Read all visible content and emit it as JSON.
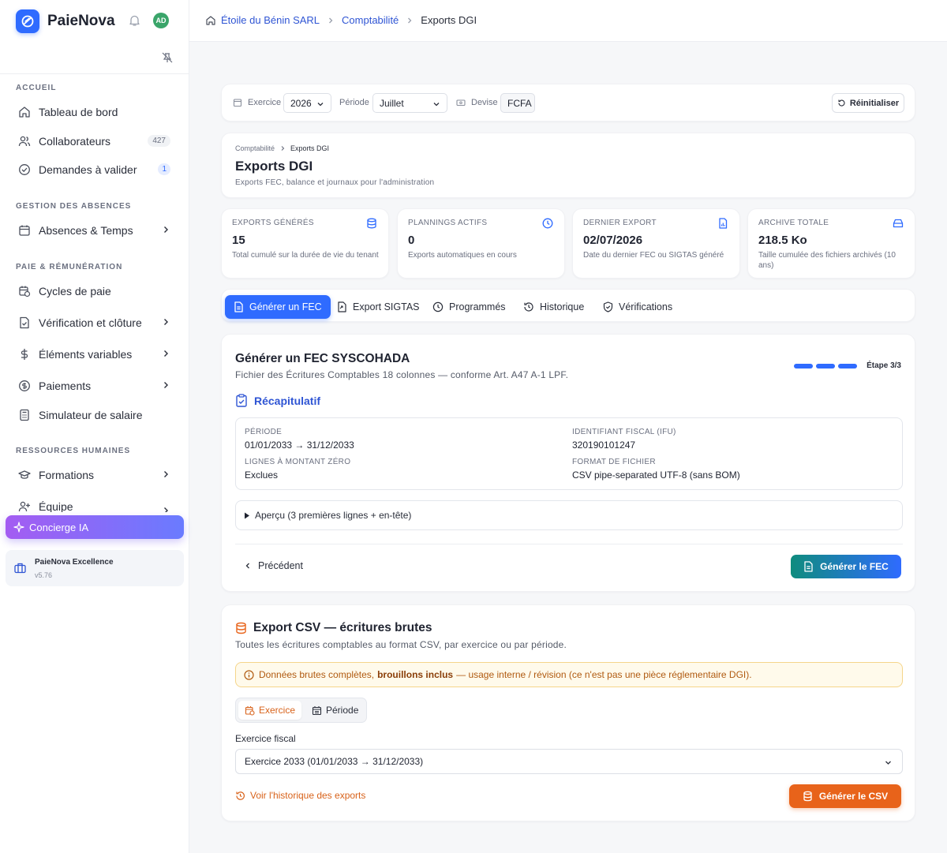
{
  "app": {
    "name": "PaieNova",
    "avatar_initials": "AD"
  },
  "sidebar": {
    "sections": [
      {
        "title": "ACCUEIL"
      },
      {
        "title": "GESTION DES ABSENCES"
      },
      {
        "title": "PAIE & RÉMUNÉRATION"
      },
      {
        "title": "RESSOURCES HUMAINES"
      }
    ],
    "items": [
      {
        "label": "Tableau de bord",
        "icon": "home-icon"
      },
      {
        "label": "Collaborateurs",
        "icon": "users-icon",
        "count": "427"
      },
      {
        "label": "Demandes à valider",
        "icon": "check-circle-icon",
        "count": "1"
      },
      {
        "label": "Absences & Temps",
        "icon": "calendar-icon"
      },
      {
        "label": "Cycles de paie",
        "icon": "calendar-clock-icon"
      },
      {
        "label": "Vérification et clôture",
        "icon": "file-check-icon"
      },
      {
        "label": "Éléments variables",
        "icon": "dollar-icon"
      },
      {
        "label": "Paiements",
        "icon": "coin-icon"
      },
      {
        "label": "Simulateur de salaire",
        "icon": "calculator-icon"
      },
      {
        "label": "Formations",
        "icon": "graduation-cap-icon"
      },
      {
        "label": "Équipe",
        "icon": "user-plus-icon"
      }
    ],
    "concierge": "Concierge IA",
    "plan": {
      "name": "PaieNova Excellence",
      "version": "v5.76"
    }
  },
  "breadcrumb": [
    "Étoile du Bénin SARL",
    "Comptabilité",
    "Exports DGI"
  ],
  "filters": {
    "exercice_label": "Exercice",
    "exercice_value": "2026",
    "periode_label": "Période",
    "periode_value": "Juillet",
    "devise_label": "Devise",
    "devise_value": "FCFA",
    "reset": "Réinitialiser"
  },
  "page": {
    "mini_crumb": [
      "Comptabilité",
      "Exports DGI"
    ],
    "title": "Exports DGI",
    "subtitle": "Exports FEC, balance et journaux pour l'administration"
  },
  "kpis": [
    {
      "label": "EXPORTS GÉNÉRÉS",
      "value": "15",
      "sub": "Total cumulé sur la durée de vie du tenant",
      "icon": "database-icon"
    },
    {
      "label": "PLANNINGS ACTIFS",
      "value": "0",
      "sub": "Exports automatiques en cours",
      "icon": "clock-icon"
    },
    {
      "label": "DERNIER EXPORT",
      "value": "02/07/2026",
      "sub": "Date du dernier FEC ou SIGTAS généré",
      "icon": "file-chart-icon"
    },
    {
      "label": "ARCHIVE TOTALE",
      "value": "218.5 Ko",
      "sub": "Taille cumulée des fichiers archivés (10 ans)",
      "icon": "archive-icon"
    }
  ],
  "tabs": [
    "Générer un FEC",
    "Export SIGTAS",
    "Programmés",
    "Historique",
    "Vérifications"
  ],
  "fec": {
    "title": "Générer un FEC SYSCOHADA",
    "subtitle": "Fichier des Écritures Comptables 18 colonnes — conforme Art. A47 A-1 LPF.",
    "step_text": "Étape 3/3",
    "steps_total": 3,
    "steps_done": 3,
    "recap_title": "Récapitulatif",
    "summary": {
      "periode_label": "PÉRIODE",
      "periode_value": "01/01/2033 → 31/12/2033",
      "zero_label": "LIGNES À MONTANT ZÉRO",
      "zero_value": "Exclues",
      "ifu_label": "IDENTIFIANT FISCAL (IFU)",
      "ifu_value": "320190101247",
      "format_label": "FORMAT DE FICHIER",
      "format_value": "CSV pipe-separated UTF-8 (sans BOM)"
    },
    "apercu": "Aperçu (3 premières lignes + en-tête)",
    "prev": "Précédent",
    "generate": "Générer le FEC"
  },
  "csv": {
    "title": "Export CSV — écritures brutes",
    "subtitle": "Toutes les écritures comptables au format CSV, par exercice ou par période.",
    "warn_pre": "Données brutes complètes,",
    "warn_bold": "brouillons inclus",
    "warn_post": "— usage interne / révision (ce n'est pas une pièce réglementaire DGI).",
    "seg_exercice": "Exercice",
    "seg_periode": "Période",
    "field_label": "Exercice fiscal",
    "field_value": "Exercice 2033 (01/01/2033 → 31/12/2033)",
    "history": "Voir l'historique des exports",
    "generate": "Générer le CSV"
  },
  "colors": {
    "primary": "#2f6bff",
    "teal": "#0f8c7e",
    "orange": "#e8631a",
    "violet": "#a45cf2"
  }
}
